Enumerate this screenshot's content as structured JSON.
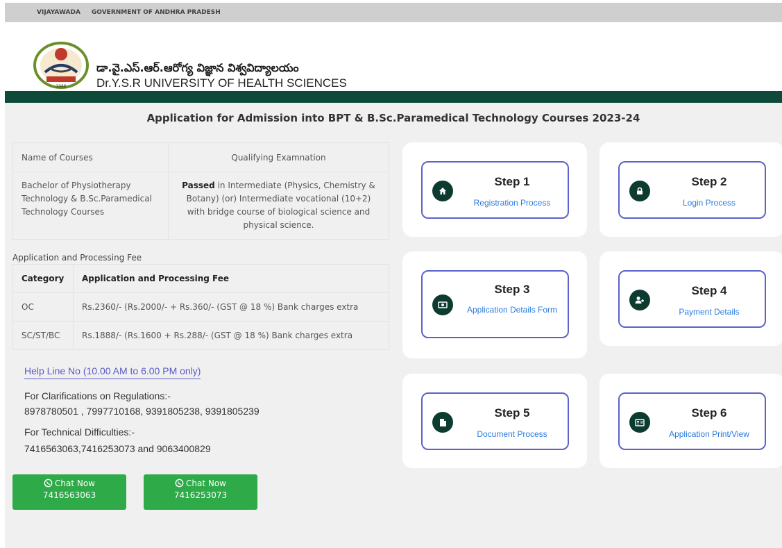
{
  "topbar": {
    "city": "VIJAYAWADA",
    "government": "GOVERNMENT OF ANDHRA PRADESH"
  },
  "header": {
    "university_telugu": "డా.వై.ఎస్.ఆర్.ఆరోగ్య విజ్ఞాన విశ్వవిద్యాలయం",
    "university_english": "Dr.Y.S.R UNIVERSITY OF HEALTH SCIENCES",
    "logo_year": "1986"
  },
  "page_title": "Application for Admission into BPT & B.Sc.Paramedical Technology Courses 2023-24",
  "courses_table": {
    "col1_header": "Name of Courses",
    "col2_header": "Qualifying Examnation",
    "course_name": "Bachelor of Physiotherapy Technology & B.Sc.Paramedical Technology Courses",
    "qualification_bold": "Passed",
    "qualification_rest": " in Intermediate (Physics, Chemistry & Botany) (or) Intermediate vocational (10+2) with bridge course of biological science and physical science."
  },
  "fee": {
    "caption": "Application and Processing Fee",
    "headers": [
      "Category",
      "Application and Processing Fee"
    ],
    "rows": [
      {
        "category": "OC",
        "fee": "Rs.2360/- (Rs.2000/- + Rs.360/- (GST @ 18 %) Bank charges extra"
      },
      {
        "category": "SC/ST/BC",
        "fee": "Rs.1888/- (Rs.1600 + Rs.288/- (GST @ 18 %) Bank charges extra"
      }
    ]
  },
  "help": {
    "helpline": "Help Line No (10.00 AM to 6.00 PM only)",
    "regulations_label": "For Clarifications on Regulations:-",
    "regulations_numbers": "8978780501 , 7997710168, 9391805238, 9391805239",
    "technical_label": "For Technical Difficulties:-",
    "technical_numbers": "7416563063,7416253073 and 9063400829"
  },
  "chat": [
    {
      "label": "Chat Now",
      "number": "7416563063"
    },
    {
      "label": "Chat Now",
      "number": "7416253073"
    }
  ],
  "steps": [
    {
      "title": "Step 1",
      "link": "Registration Process",
      "icon": "home-icon"
    },
    {
      "title": "Step 2",
      "link": "Login Process",
      "icon": "lock-icon"
    },
    {
      "title": "Step 3",
      "link": "Application Details Form",
      "icon": "money-icon"
    },
    {
      "title": "Step 4",
      "link": "Payment Details",
      "icon": "user-plus-icon"
    },
    {
      "title": "Step 5",
      "link": "Document Process",
      "icon": "file-icon"
    },
    {
      "title": "Step 6",
      "link": "Application Print/View",
      "icon": "id-card-icon"
    }
  ],
  "colors": {
    "accent_green": "#0e4a3a",
    "step_border": "#5b62c9",
    "chat_green": "#2eaa48",
    "link_blue": "#2a7be0"
  }
}
